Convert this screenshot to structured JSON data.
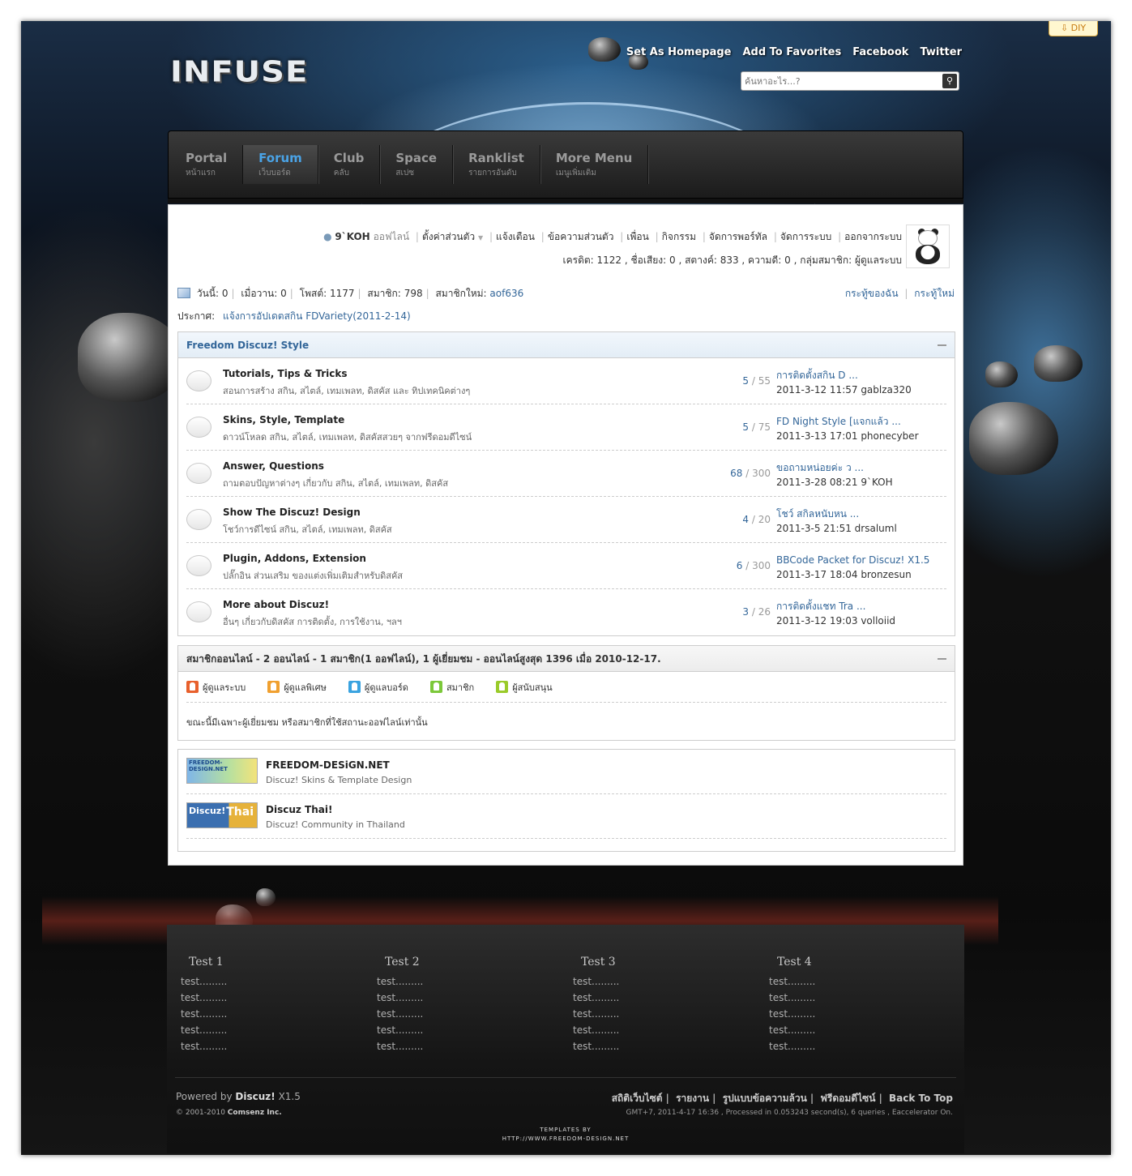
{
  "diy": "DIY",
  "header": {
    "logo_text": "INFUSE",
    "top_links": [
      "Set As Homepage",
      "Add To Favorites",
      "Facebook",
      "Twitter"
    ],
    "search_placeholder": "ค้นหาอะไร...?"
  },
  "nav": [
    {
      "en": "Portal",
      "th": "หน้าแรก"
    },
    {
      "en": "Forum",
      "th": "เว็บบอร์ด"
    },
    {
      "en": "Club",
      "th": "คลับ"
    },
    {
      "en": "Space",
      "th": "สเปซ"
    },
    {
      "en": "Ranklist",
      "th": "รายการอันดับ"
    },
    {
      "en": "More Menu",
      "th": "เมนูเพิ่มเติม"
    }
  ],
  "user": {
    "name": "9`KOH",
    "status": "ออฟไลน์",
    "links": [
      "ตั้งค่าส่วนตัว",
      "แจ้งเตือน",
      "ข้อความส่วนตัว",
      "เพื่อน",
      "กิจกรรม",
      "จัดการพอร์ทัล",
      "จัดการระบบ",
      "ออกจากระบบ"
    ],
    "info": "เครดิต: 1122 , ชื่อเสียง: 0 , สตางค์: 833 , ความดี: 0 , กลุ่มสมาชิก: ผู้ดูแลระบบ"
  },
  "stats": {
    "today_label": "วันนี้:",
    "today": "0",
    "yesterday_label": "เมื่อวาน:",
    "yesterday": "0",
    "posts_label": "โพสต์:",
    "posts": "1177",
    "members_label": "สมาชิก:",
    "members": "798",
    "newest_label": "สมาชิกใหม่:",
    "newest": "aof636",
    "my_threads": "กระทู้ของฉัน",
    "new_threads": "กระทู้ใหม่"
  },
  "announcement": {
    "label": "ประกาศ:",
    "text": "แจ้งการอัปเดตสกิน FDVariety(2011-2-14)"
  },
  "forum_group": {
    "title": "Freedom Discuz! Style",
    "forums": [
      {
        "name": "Tutorials, Tips & Tricks",
        "desc": "สอนการสร้าง สกิน, สไตล์, เทมเพลท, ดิสคัส  และ ทิปเทคนิคต่างๆ",
        "threads": "5",
        "posts": "55",
        "last_title": "การติดตั้งสกิน D ...",
        "last_meta": "2011-3-12 11:57 gablza320"
      },
      {
        "name": "Skins, Style, Template",
        "desc": "ดาวน์โหลด สกิน, สไตล์, เทมเพลท, ดิสคัสสวยๆ จากฟรีดอมดีไซน์",
        "threads": "5",
        "posts": "75",
        "last_title": "FD Night Style [แจกแล้ว ...",
        "last_meta": "2011-3-13 17:01 phonecyber"
      },
      {
        "name": "Answer, Questions",
        "desc": "ถามตอบปัญหาต่างๆ เกี่ยวกับ สกิน, สไตล์, เทมเพลท, ดิสคัส",
        "threads": "68",
        "posts": "300",
        "last_title": "ขอถามหน่อยค่ะ ว ...",
        "last_meta": "2011-3-28 08:21 9`KOH"
      },
      {
        "name": "Show The Discuz! Design",
        "desc": "โชว์การดีไซน์ สกิน, สไตล์, เทมเพลท, ดิสคัส",
        "threads": "4",
        "posts": "20",
        "last_title": "โชว์ สกิลหนับหน ...",
        "last_meta": "2011-3-5 21:51 drsaluml"
      },
      {
        "name": "Plugin, Addons, Extension",
        "desc": "ปลั๊กอิน ส่วนเสริม ของแต่งเพิ่มเติมสำหรับดิสคัส",
        "threads": "6",
        "posts": "300",
        "last_title": "BBCode Packet for Discuz! X1.5",
        "last_meta": "2011-3-17 18:04 bronzesun"
      },
      {
        "name": "More about Discuz!",
        "desc": "อื่นๆ เกี่ยวกับดิสคัส การติดตั้ง, การใช้งาน, ฯลฯ",
        "threads": "3",
        "posts": "26",
        "last_title": "การติดตั้งแชท Tra ...",
        "last_meta": "2011-3-12 19:03 volloiid"
      }
    ]
  },
  "online": {
    "title": "สมาชิกออนไลน์ - 2 ออนไลน์ - 1 สมาชิก(1 ออฟไลน์), 1 ผู้เยี่ยมชม - ออนไลน์สูงสุด 1396 เมื่อ 2010-12-17.",
    "legend": [
      {
        "label": "ผู้ดูแลระบบ",
        "color": "#e8602c"
      },
      {
        "label": "ผู้ดูแลพิเศษ",
        "color": "#f0a030"
      },
      {
        "label": "ผู้ดูแลบอร์ด",
        "color": "#3aa3e0"
      },
      {
        "label": "สมาชิก",
        "color": "#7cc83a"
      },
      {
        "label": "ผู้สนับสนุน",
        "color": "#9acb2a"
      }
    ],
    "note": "ขณะนี้มีเฉพาะผู้เยี่ยมชม หรือสมาชิกที่ใช้สถานะออฟไลน์เท่านั้น"
  },
  "links": [
    {
      "logo": "FREEDOM-DESIGN.NET",
      "name": "FREEDOM-DESiGN.NET",
      "desc": "Discuz! Skins & Template Design"
    },
    {
      "logo": "Discuz!",
      "logo2": "Thai",
      "name": "Discuz Thai!",
      "desc": "Discuz! Community in Thailand"
    }
  ],
  "footer": {
    "columns": [
      {
        "title": "Test 1",
        "items": [
          "test.........",
          "test.........",
          "test.........",
          "test.........",
          "test........."
        ]
      },
      {
        "title": "Test 2",
        "items": [
          "test.........",
          "test.........",
          "test.........",
          "test.........",
          "test........."
        ]
      },
      {
        "title": "Test 3",
        "items": [
          "test.........",
          "test.........",
          "test.........",
          "test.........",
          "test........."
        ]
      },
      {
        "title": "Test 4",
        "items": [
          "test.........",
          "test.........",
          "test.........",
          "test.........",
          "test........."
        ]
      }
    ],
    "powered_prefix": "Powered by",
    "powered_brand": "Discuz!",
    "powered_version": "X1.5",
    "copyright_prefix": "© 2001-2010",
    "copyright_company": "Comsenz Inc.",
    "links": [
      "สถิติเว็บไซต์",
      "รายงาน",
      "รูปแบบข้อความล้วน",
      "ฟรีดอมดีไซน์",
      "Back To Top"
    ],
    "info": "GMT+7, 2011-4-17 16:36 , Processed in 0.053243 second(s), 6 queries , Eaccelerator On.",
    "credit_line1": "TEMPLATES BY",
    "credit_line2": "HTTP://WWW.FREEDOM-DESIGN.NET"
  },
  "colors": {
    "link": "#336699",
    "nav_active": "#4aa3e6",
    "diy_border": "#d6a33a"
  }
}
